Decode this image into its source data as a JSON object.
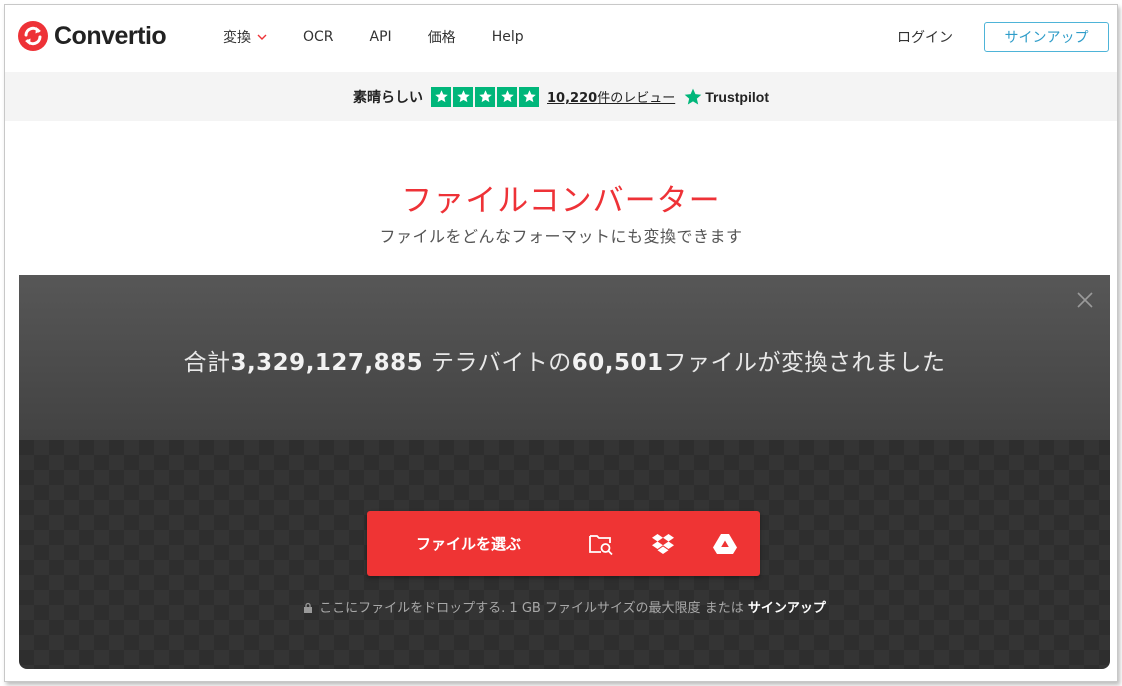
{
  "brand": {
    "name": "Convertio",
    "accent": "#ee3237"
  },
  "nav": {
    "items": [
      {
        "label": "変換",
        "has_dropdown": true
      },
      {
        "label": "OCR"
      },
      {
        "label": "API"
      },
      {
        "label": "価格"
      },
      {
        "label": "Help"
      }
    ],
    "login": "ログイン",
    "signup": "サインアップ"
  },
  "trustpilot": {
    "rating_word": "素晴らしい",
    "stars": 5,
    "review_count": "10,220",
    "review_suffix": "件のレビュー",
    "brand": "Trustpilot",
    "star_color": "#00b67a"
  },
  "hero": {
    "title": "ファイルコンバーター",
    "subtitle": "ファイルをどんなフォーマットにも変換できます"
  },
  "stats": {
    "prefix": "合計",
    "terabytes": "3,329,127,885",
    "middle": " テラバイトの",
    "files": "60,501",
    "suffix": "ファイルが変換されました"
  },
  "upload": {
    "choose_label": "ファイルを選ぶ",
    "icons": [
      "folder-search-icon",
      "dropbox-icon",
      "google-drive-icon"
    ],
    "hint": "ここにファイルをドロップする. 1 GB ファイルサイズの最大限度 または ",
    "hint_link": "サインアップ"
  }
}
